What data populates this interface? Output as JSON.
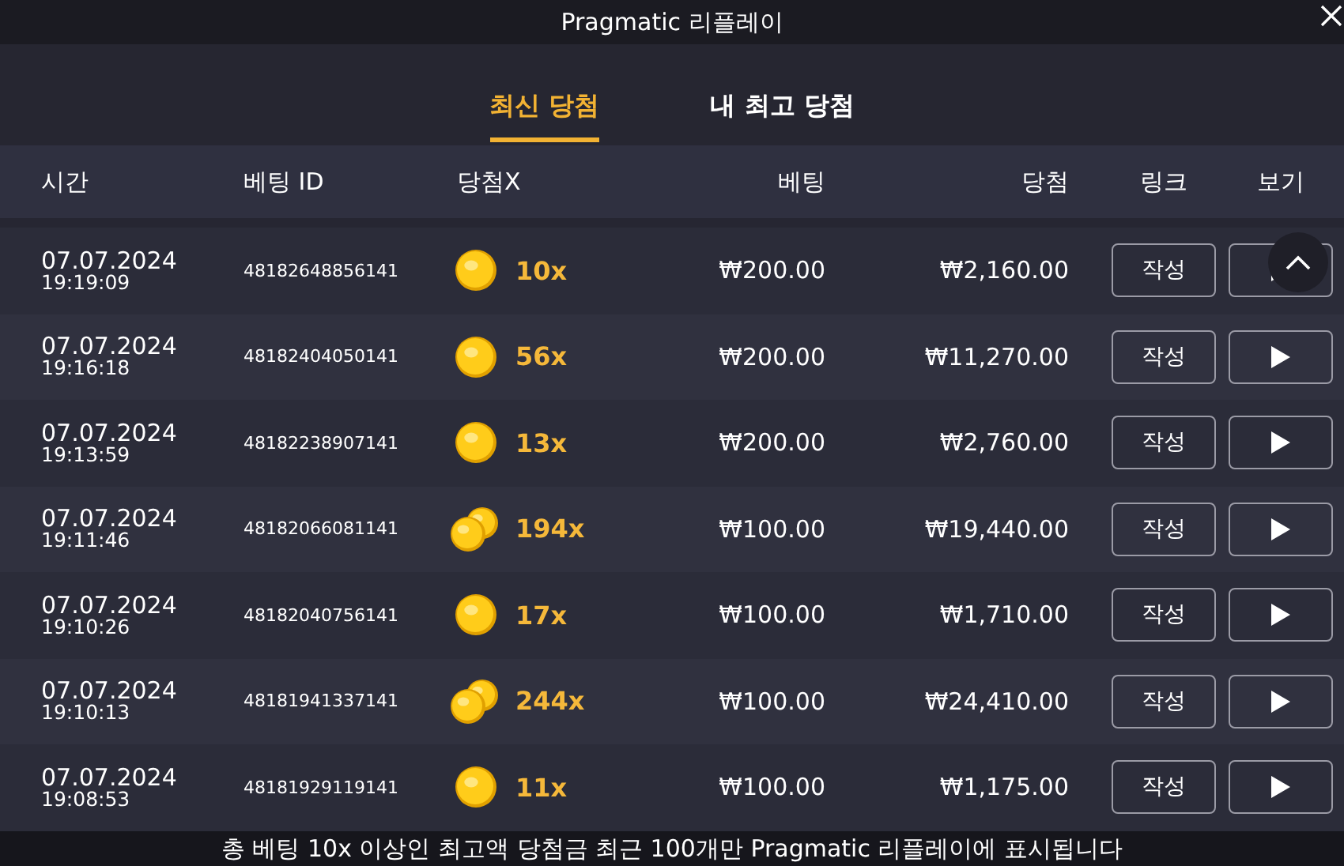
{
  "window": {
    "title": "Pragmatic 리플레이"
  },
  "tabs": [
    {
      "label": "최신 당첨",
      "selected": true
    },
    {
      "label": "내 최고 당첨",
      "selected": false
    }
  ],
  "table": {
    "columns": [
      "시간",
      "베팅 ID",
      "당첨X",
      "베팅",
      "당첨",
      "링크",
      "보기"
    ],
    "rows": [
      {
        "date": "07.07.2024",
        "time": "19:19:09",
        "bet_id": "48182648856141",
        "kind": "single",
        "multiplier": "10x",
        "bet": "₩200.00",
        "win": "₩2,160.00",
        "link": "작성"
      },
      {
        "date": "07.07.2024",
        "time": "19:16:18",
        "bet_id": "48182404050141",
        "kind": "single",
        "multiplier": "56x",
        "bet": "₩200.00",
        "win": "₩11,270.00",
        "link": "작성"
      },
      {
        "date": "07.07.2024",
        "time": "19:13:59",
        "bet_id": "48182238907141",
        "kind": "single",
        "multiplier": "13x",
        "bet": "₩200.00",
        "win": "₩2,760.00",
        "link": "작성"
      },
      {
        "date": "07.07.2024",
        "time": "19:11:46",
        "bet_id": "48182066081141",
        "kind": "double",
        "multiplier": "194x",
        "bet": "₩100.00",
        "win": "₩19,440.00",
        "link": "작성"
      },
      {
        "date": "07.07.2024",
        "time": "19:10:26",
        "bet_id": "48182040756141",
        "kind": "single",
        "multiplier": "17x",
        "bet": "₩100.00",
        "win": "₩1,710.00",
        "link": "작성"
      },
      {
        "date": "07.07.2024",
        "time": "19:10:13",
        "bet_id": "48181941337141",
        "kind": "double",
        "multiplier": "244x",
        "bet": "₩100.00",
        "win": "₩24,410.00",
        "link": "작성"
      },
      {
        "date": "07.07.2024",
        "time": "19:08:53",
        "bet_id": "48181929119141",
        "kind": "single",
        "multiplier": "11x",
        "bet": "₩100.00",
        "win": "₩1,175.00",
        "link": "작성"
      }
    ]
  },
  "footer": "총 베팅 10x 이상인 최고액 당첨금 최근 100개만 Pragmatic 리플레이에 표시됩니다"
}
